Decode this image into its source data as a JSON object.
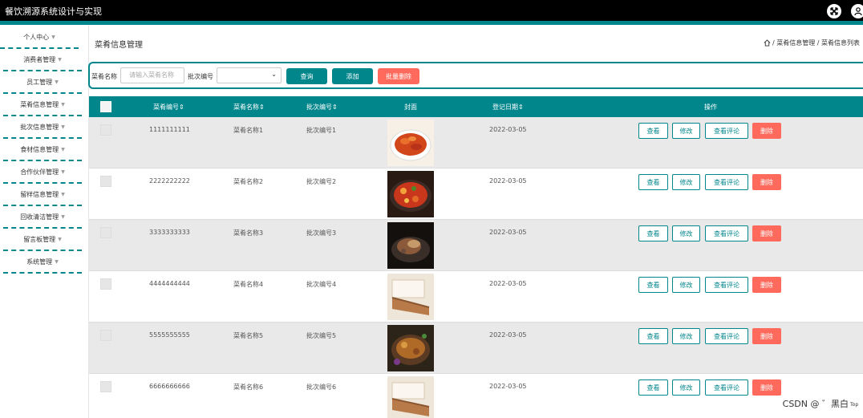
{
  "app": {
    "title": "餐饮溯源系统设计与实现"
  },
  "sidebar": {
    "items": [
      {
        "label": "个人中心"
      },
      {
        "label": "消费者管理"
      },
      {
        "label": "员工管理"
      },
      {
        "label": "菜肴信息管理"
      },
      {
        "label": "批次信息管理"
      },
      {
        "label": "食材信息管理"
      },
      {
        "label": "合作伙伴管理"
      },
      {
        "label": "留样信息管理"
      },
      {
        "label": "回收清洁管理"
      },
      {
        "label": "留言板管理"
      },
      {
        "label": "系统管理"
      }
    ]
  },
  "page": {
    "title": "菜肴信息管理",
    "breadcrumb": "/ 菜肴信息管理 / 菜肴信息列表"
  },
  "search": {
    "name_label": "菜肴名称",
    "name_placeholder": "请输入菜肴名称",
    "batch_label": "批次编号",
    "batch_value": "",
    "query": "查询",
    "add": "添加",
    "batch_delete": "批量删除"
  },
  "table": {
    "headers": [
      "菜肴编号",
      "菜肴名称",
      "批次编号",
      "封面",
      "登记日期",
      "操作"
    ],
    "actions": {
      "view": "查看",
      "edit": "修改",
      "comments": "查看评论",
      "delete": "删除"
    },
    "rows": [
      {
        "code": "1111111111",
        "name": "菜肴名称1",
        "batch": "批次编号1",
        "date": "2022-03-05"
      },
      {
        "code": "2222222222",
        "name": "菜肴名称2",
        "batch": "批次编号2",
        "date": "2022-03-05"
      },
      {
        "code": "3333333333",
        "name": "菜肴名称3",
        "batch": "批次编号3",
        "date": "2022-03-05"
      },
      {
        "code": "4444444444",
        "name": "菜肴名称4",
        "batch": "批次编号4",
        "date": "2022-03-05"
      },
      {
        "code": "5555555555",
        "name": "菜肴名称5",
        "batch": "批次编号5",
        "date": "2022-03-05"
      },
      {
        "code": "6666666666",
        "name": "菜肴名称6",
        "batch": "批次编号6",
        "date": "2022-03-05"
      }
    ]
  },
  "watermark": "CSDN @ ゛黑白",
  "top_button": "Top",
  "colors": {
    "accent": "#00868b",
    "danger": "#ff6a5c",
    "topbar": "#000000"
  }
}
